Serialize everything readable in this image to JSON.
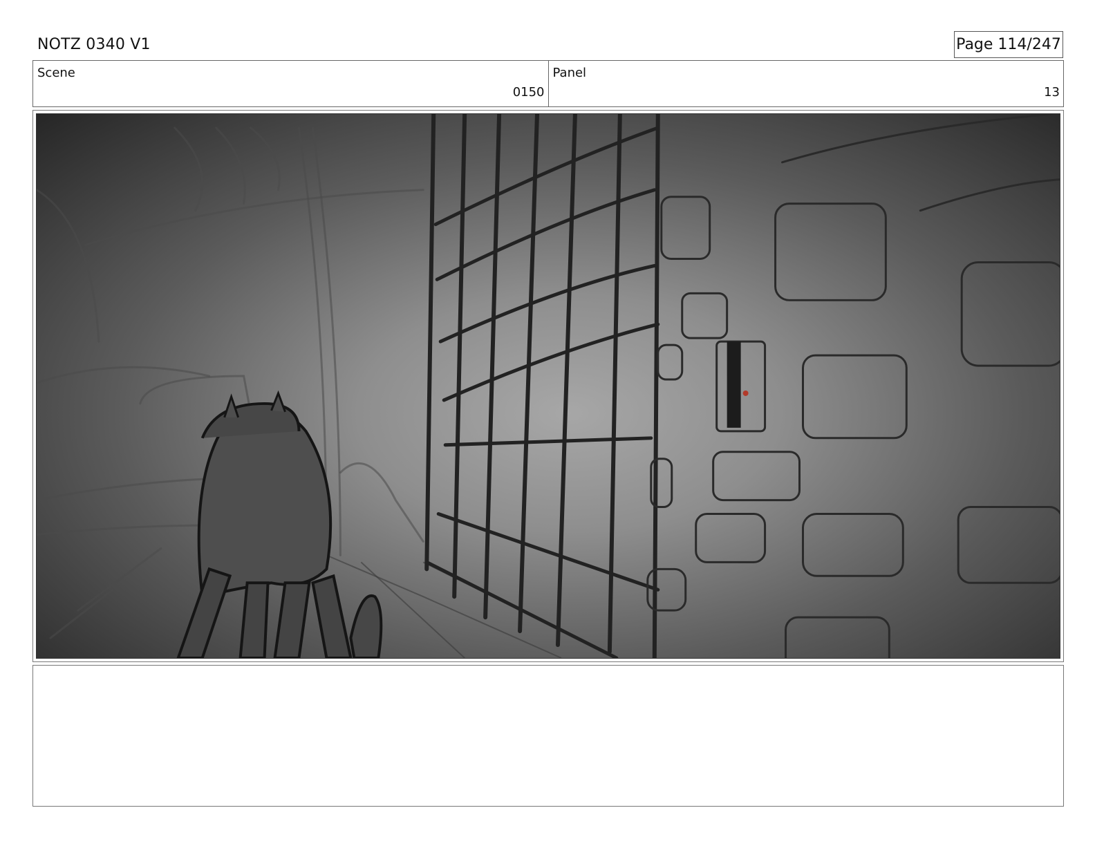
{
  "header": {
    "title": "NOTZ 0340 V1",
    "page": "Page 114/247"
  },
  "info": {
    "scene_label": "Scene",
    "scene_value": "0150",
    "panel_label": "Panel",
    "panel_value": "13"
  },
  "frame": {
    "image": "storyboard-sketch"
  },
  "notes": {
    "text": ""
  }
}
